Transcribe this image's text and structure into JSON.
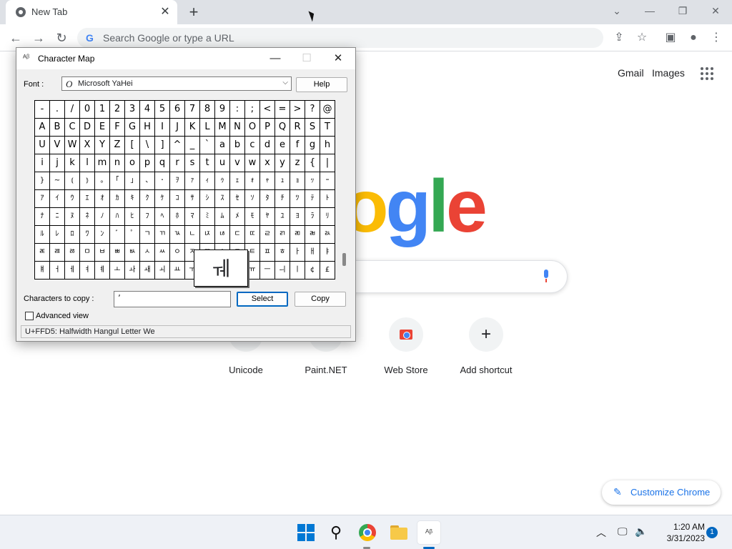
{
  "browser": {
    "tab_title": "New Tab",
    "omnibox_placeholder": "Search Google or type a URL",
    "ntp": {
      "gmail": "Gmail",
      "images": "Images",
      "logo_letters": [
        "o",
        "g",
        "l",
        "e"
      ],
      "logo_colors": [
        "#fbbc05",
        "#4285f4",
        "#34a853",
        "#ea4335"
      ],
      "shortcuts": [
        {
          "label": "Unicode"
        },
        {
          "label": "Paint.NET"
        },
        {
          "label": "Web Store",
          "icon": "web-store-icon"
        },
        {
          "label": "Add shortcut",
          "icon": "plus-icon"
        }
      ],
      "customize_label": "Customize Chrome"
    }
  },
  "charmap": {
    "title": "Character Map",
    "font_label": "Font :",
    "font_name": "Microsoft YaHei",
    "help_label": "Help",
    "grid": [
      [
        "-",
        ".",
        "/",
        "0",
        "1",
        "2",
        "3",
        "4",
        "5",
        "6",
        "7",
        "8",
        "9",
        ":",
        ";",
        "<",
        "=",
        ">",
        "?",
        "@"
      ],
      [
        "A",
        "B",
        "C",
        "D",
        "E",
        "F",
        "G",
        "H",
        "I",
        "J",
        "K",
        "L",
        "M",
        "N",
        "O",
        "P",
        "Q",
        "R",
        "S",
        "T"
      ],
      [
        "U",
        "V",
        "W",
        "X",
        "Y",
        "Z",
        "[",
        "\\",
        "]",
        "^",
        "_",
        "`",
        "a",
        "b",
        "c",
        "d",
        "e",
        "f",
        "g",
        "h"
      ],
      [
        "i",
        "j",
        "k",
        "l",
        "m",
        "n",
        "o",
        "p",
        "q",
        "r",
        "s",
        "t",
        "u",
        "v",
        "w",
        "x",
        "y",
        "z",
        "{",
        "|"
      ],
      [
        "}",
        "~",
        "⦅",
        "⦆",
        "｡",
        "｢",
        "｣",
        "､",
        "･",
        "ｦ",
        "ｧ",
        "ｨ",
        "ｩ",
        "ｪ",
        "ｫ",
        "ｬ",
        "ｭ",
        "ｮ",
        "ｯ",
        "ｰ"
      ],
      [
        "ｱ",
        "ｲ",
        "ｳ",
        "ｴ",
        "ｵ",
        "ｶ",
        "ｷ",
        "ｸ",
        "ｹ",
        "ｺ",
        "ｻ",
        "ｼ",
        "ｽ",
        "ｾ",
        "ｿ",
        "ﾀ",
        "ﾁ",
        "ﾂ",
        "ﾃ",
        "ﾄ"
      ],
      [
        "ﾅ",
        "ﾆ",
        "ﾇ",
        "ﾈ",
        "ﾉ",
        "ﾊ",
        "ﾋ",
        "ﾌ",
        "ﾍ",
        "ﾎ",
        "ﾏ",
        "ﾐ",
        "ﾑ",
        "ﾒ",
        "ﾓ",
        "ﾔ",
        "ﾕ",
        "ﾖ",
        "ﾗ",
        "ﾘ"
      ],
      [
        "ﾙ",
        "ﾚ",
        "ﾛ",
        "ﾜ",
        "ﾝ",
        "ﾞ",
        "ﾟ",
        "ﾡ",
        "ﾢ",
        "ﾣ",
        "ﾤ",
        "ﾥ",
        "ﾦ",
        "ﾧ",
        "ﾨ",
        "ﾩ",
        "ﾪ",
        "ﾫ",
        "ﾬ",
        "ﾭ"
      ],
      [
        "ﾮ",
        "ﾯ",
        "ﾰ",
        "ﾱ",
        "ﾲ",
        "ﾳ",
        "ﾴ",
        "ﾵ",
        "ﾶ",
        "ﾷ",
        "ﾸ",
        "ﾹ",
        "ﾺ",
        "ﾻ",
        "ﾼ",
        "ﾽ",
        "ﾾ",
        "ￂ",
        "ￃ",
        "ￄ"
      ],
      [
        "ￅ",
        "ￆ",
        "ￇ",
        "ￊ",
        "ￋ",
        "ￌ",
        "ￍ",
        "ￎ",
        "ￏ",
        "ￒ",
        "ￓ",
        "ￔ",
        "ￕ",
        "ￖ",
        "ￗ",
        "ￚ",
        "ￛ",
        "ￜ",
        "¢",
        "£"
      ]
    ],
    "magnified_char": "ￕ",
    "chars_to_copy_label": "Characters to copy :",
    "chars_to_copy_value": "ʼ",
    "select_label": "Select",
    "copy_label": "Copy",
    "advanced_view_label": "Advanced view",
    "status_text": "U+FFD5: Halfwidth Hangul Letter We"
  },
  "taskbar": {
    "time": "1:20 AM",
    "date": "3/31/2023",
    "notification_count": "1",
    "accent_color": "#0067c0"
  }
}
